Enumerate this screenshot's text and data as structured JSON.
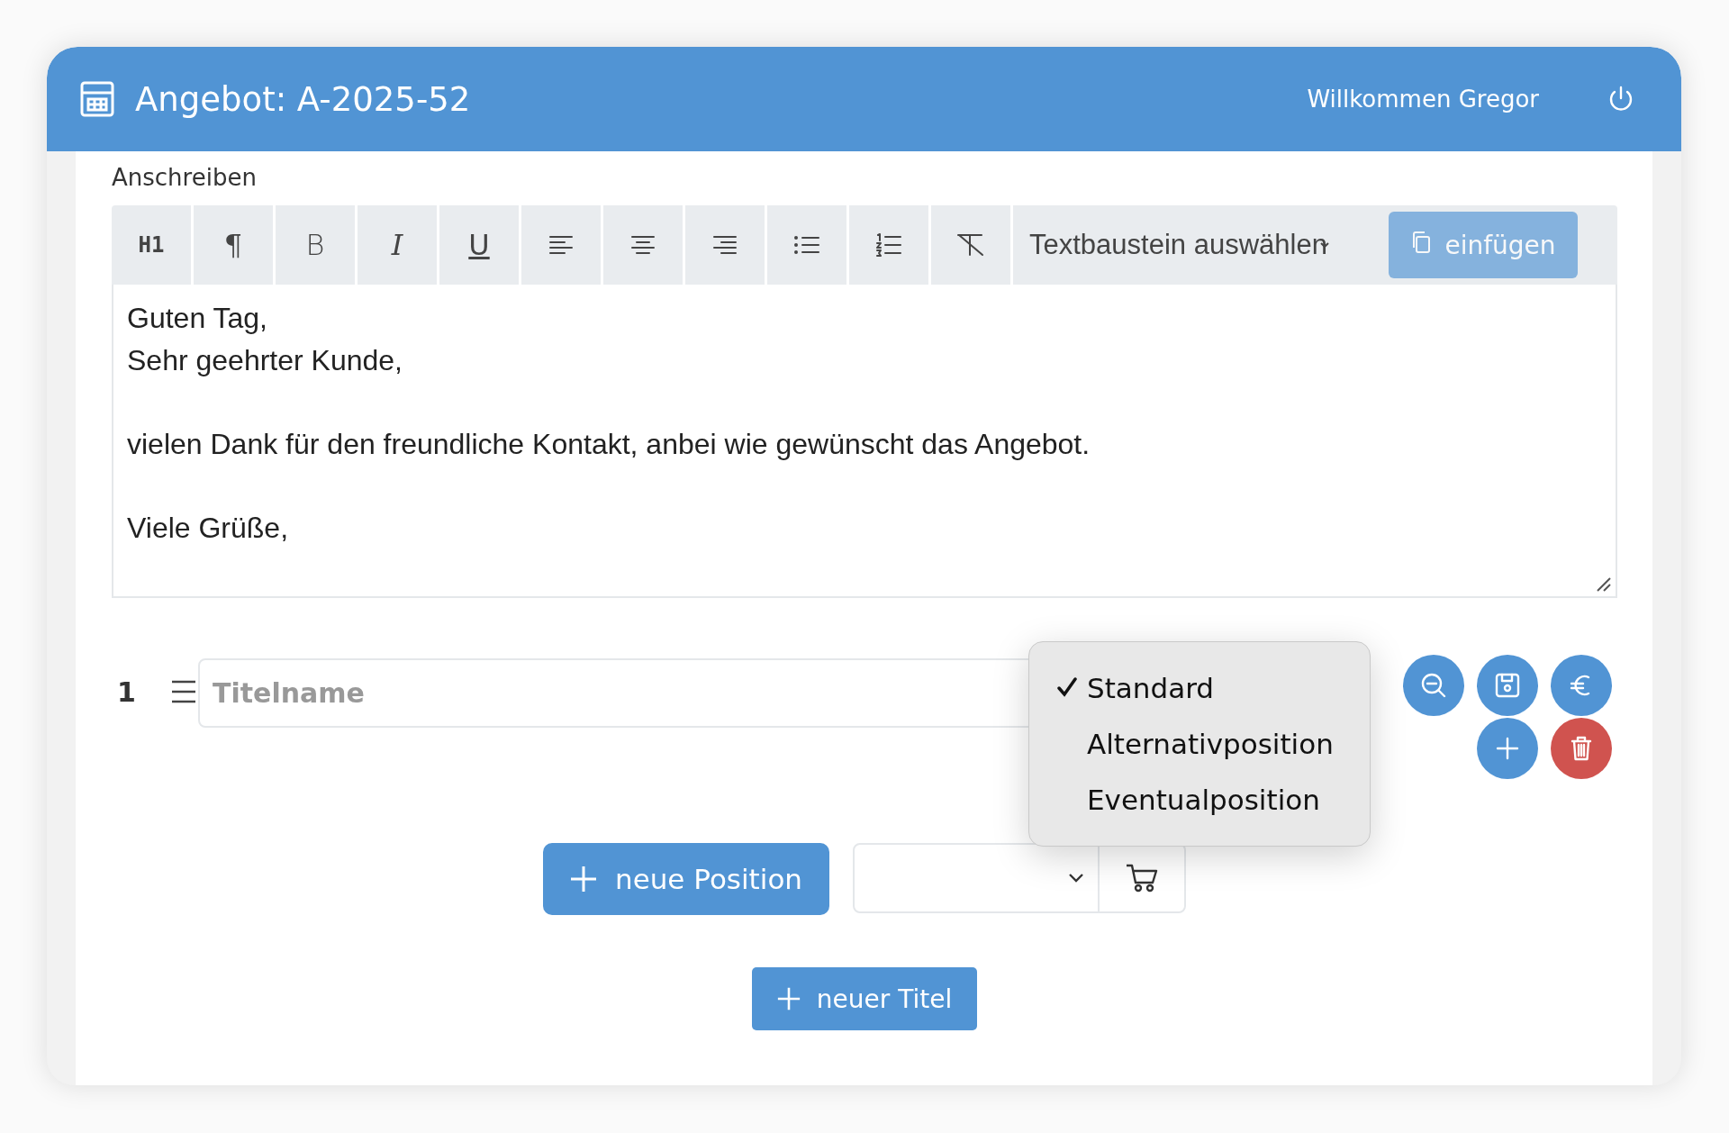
{
  "header": {
    "title": "Angebot: A-2025-52",
    "greeting": "Willkommen Gregor"
  },
  "section_label": "Anschreiben",
  "toolbar": {
    "buttons": [
      {
        "kind": "heading",
        "label": "H1"
      },
      {
        "kind": "paragraph",
        "label": "¶"
      },
      {
        "kind": "bold",
        "label": "B"
      },
      {
        "kind": "italic",
        "label": "I"
      },
      {
        "kind": "underline",
        "label": "U"
      },
      {
        "kind": "align-left"
      },
      {
        "kind": "align-center"
      },
      {
        "kind": "align-right"
      },
      {
        "kind": "bullet-list"
      },
      {
        "kind": "numbered-list"
      },
      {
        "kind": "clear-format"
      }
    ],
    "template_select": {
      "value": "Textbaustein auswählen"
    },
    "insert_button": {
      "label": "einfügen",
      "disabled": true
    }
  },
  "editor": {
    "paragraphs": [
      [
        "Guten Tag,",
        "Sehr geehrter Kunde,"
      ],
      [
        "vielen Dank für den freundliche Kontakt, anbei wie gewünscht das Angebot."
      ],
      [
        "Viele Grüße,"
      ]
    ]
  },
  "positions": [
    {
      "number": "1",
      "title_placeholder": "Titelname",
      "menu": [
        {
          "label": "Standard",
          "selected": true
        },
        {
          "label": "Alternativposition",
          "selected": false
        },
        {
          "label": "Eventualposition",
          "selected": false
        }
      ],
      "actions": [
        {
          "kind": "zoom-out"
        },
        {
          "kind": "save"
        },
        {
          "kind": "euro"
        },
        {
          "kind": "add"
        },
        {
          "kind": "delete"
        }
      ]
    }
  ],
  "new_position_button": {
    "label": "neue Position"
  },
  "new_title_button": {
    "label": "neuer Titel"
  }
}
